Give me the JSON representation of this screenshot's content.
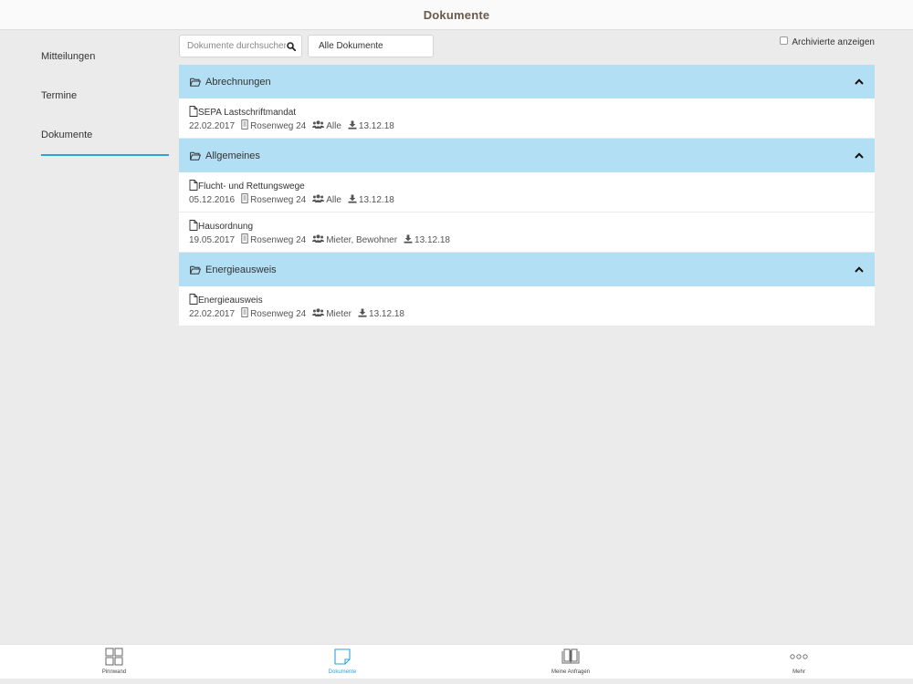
{
  "header": {
    "title": "Dokumente"
  },
  "sidebar": {
    "items": [
      {
        "label": "Mitteilungen"
      },
      {
        "label": "Termine"
      },
      {
        "label": "Dokumente"
      }
    ]
  },
  "toolbar": {
    "search_placeholder": "Dokumente durchsuchen",
    "filter_value": "Alle Dokumente",
    "archive_label": "Archivierte anzeigen",
    "archive_checked": false
  },
  "groups": [
    {
      "name": "Abrechnungen",
      "docs": [
        {
          "title": "SEPA Lastschriftmandat",
          "date": "22.02.2017",
          "location": "Rosenweg 24",
          "audience": "Alle",
          "download": "13.12.18"
        }
      ]
    },
    {
      "name": "Allgemeines",
      "docs": [
        {
          "title": "Flucht- und Rettungswege",
          "date": "05.12.2016",
          "location": "Rosenweg 24",
          "audience": "Alle",
          "download": "13.12.18"
        },
        {
          "title": "Hausordnung",
          "date": "19.05.2017",
          "location": "Rosenweg 24",
          "audience": "Mieter, Bewohner",
          "download": "13.12.18"
        }
      ]
    },
    {
      "name": "Energieausweis",
      "docs": [
        {
          "title": "Energieausweis",
          "date": "22.02.2017",
          "location": "Rosenweg 24",
          "audience": "Mieter",
          "download": "13.12.18"
        }
      ]
    }
  ],
  "tabbar": {
    "tabs": [
      {
        "label": "Pinnwand",
        "icon": "grid-icon"
      },
      {
        "label": "Dokumente",
        "icon": "document-icon"
      },
      {
        "label": "Meine Anfragen",
        "icon": "book-icon"
      },
      {
        "label": "Mehr",
        "icon": "more-icon"
      }
    ]
  },
  "colors": {
    "accent": "#2ea3d9",
    "group_header": "#b3dff4",
    "title": "#6b5a4a"
  }
}
